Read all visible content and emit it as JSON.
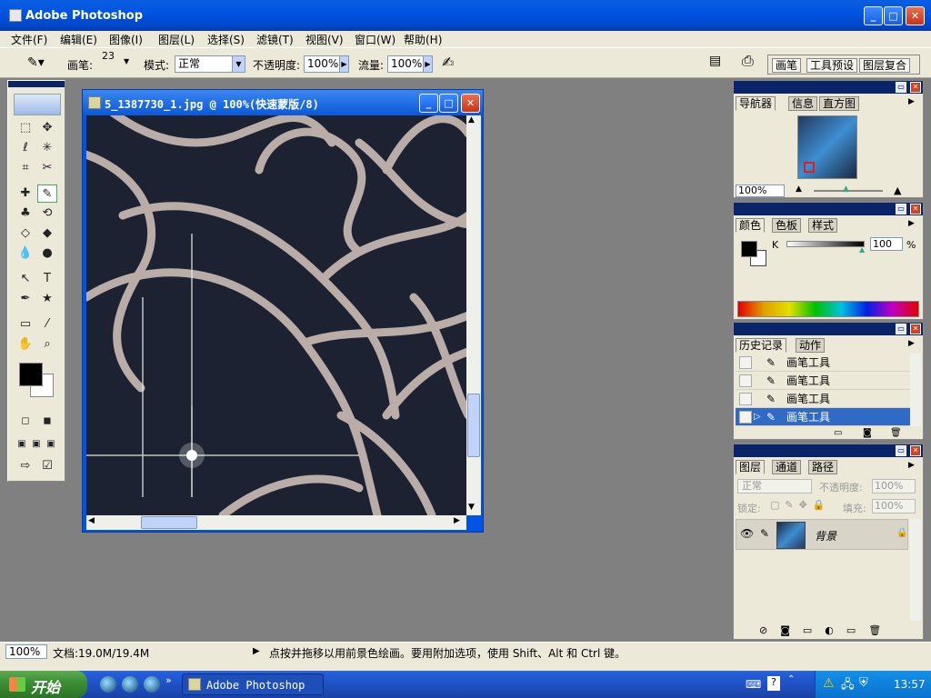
{
  "window": {
    "title": "Adobe Photoshop"
  },
  "menu": [
    "文件(F)",
    "编辑(E)",
    "图像(I)",
    "图层(L)",
    "选择(S)",
    "滤镜(T)",
    "视图(V)",
    "窗口(W)",
    "帮助(H)"
  ],
  "options": {
    "brush_label": "画笔:",
    "brush_size": "23",
    "mode_label": "模式:",
    "mode_value": "正常",
    "opacity_label": "不透明度:",
    "opacity_value": "100%",
    "flow_label": "流量:",
    "flow_value": "100%"
  },
  "palette_well": [
    "画笔",
    "工具预设",
    "图层复合"
  ],
  "document": {
    "title": "5_1387730_1.jpg @ 100%(快速蒙版/8)"
  },
  "navigator": {
    "tabs": [
      "导航器",
      "信息",
      "直方图"
    ],
    "zoom": "100%"
  },
  "color": {
    "tabs": [
      "颜色",
      "色板",
      "样式"
    ],
    "channel": "K",
    "value": "100",
    "unit": "%"
  },
  "history": {
    "tabs": [
      "历史记录",
      "动作"
    ],
    "items": [
      "画笔工具",
      "画笔工具",
      "画笔工具",
      "画笔工具"
    ]
  },
  "layers": {
    "tabs": [
      "图层",
      "通道",
      "路径"
    ],
    "blend": "正常",
    "opacity_label": "不透明度:",
    "opacity_value": "100%",
    "lock_label": "锁定:",
    "fill_label": "填充:",
    "fill_value": "100%",
    "layer_name": "背景"
  },
  "status": {
    "zoom": "100%",
    "doc": "文档:19.0M/19.4M",
    "hint": "点按并拖移以用前景色绘画。要用附加选项，使用 Shift、Alt 和 Ctrl 键。"
  },
  "taskbar": {
    "start": "开始",
    "item": "Adobe Photoshop",
    "time": "13:57"
  },
  "colors": {
    "titlebar": "#0054e3",
    "workspace": "#808080",
    "selection": "#316ac5"
  }
}
